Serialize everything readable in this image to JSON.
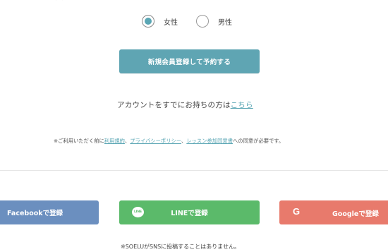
{
  "gender": {
    "options": [
      {
        "label": "女性",
        "selected": true
      },
      {
        "label": "男性",
        "selected": false
      }
    ]
  },
  "register": {
    "label": "新規会員登録して予約する"
  },
  "login": {
    "prefix": "アカウントをすでにお持ちの方は",
    "link": "こちら"
  },
  "consent": {
    "prefix": "※ご利用いただく前に",
    "terms_link": "利用規約",
    "sep1": "、",
    "privacy_link": "プライバシーポリシー",
    "sep2": "、",
    "agreement_link": "レッスン参加同意書",
    "suffix": "への同意が必要です。"
  },
  "social": {
    "facebook": {
      "label": "Facebookで登録",
      "color": "#6b8fbf"
    },
    "line": {
      "label": "LINEで登録",
      "icon": "line-icon",
      "icon_text": "LINE",
      "color": "#5bba6a"
    },
    "google": {
      "label": "Googleで登録",
      "icon": "google-icon",
      "icon_text": "G",
      "color": "#e87a6c"
    }
  },
  "sns_note": "※SOELUがSNSに投稿することはありません。",
  "colors": {
    "accent": "#5fa5b3"
  }
}
